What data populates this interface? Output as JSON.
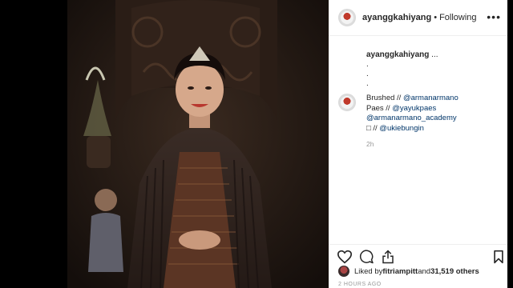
{
  "post": {
    "username": "ayanggkahiyang",
    "separator": "•",
    "follow_status": "Following"
  },
  "caption": {
    "username": "ayanggkahiyang",
    "text": "...",
    "dot1": ".",
    "dot2": ".",
    "dot3": "."
  },
  "comment": {
    "line1_prefix": "Brushed // ",
    "line1_mention": "@armanarmano",
    "line2_prefix": "Paes // ",
    "line2_mention": "@yayukpaes",
    "line3_mention": "@armanarmano_academy",
    "line4_prefix": "□ // ",
    "line4_mention": "@ukiebungin",
    "time": "2h"
  },
  "likes": {
    "prefix": "Liked by ",
    "user": "fitriampitt",
    "middle": " and ",
    "count": "31,519 others"
  },
  "posted_ago": "2 HOURS AGO",
  "icons": {
    "more": "more-options-icon",
    "like": "heart-icon",
    "comment": "comment-icon",
    "share": "share-icon",
    "save": "bookmark-icon"
  },
  "colors": {
    "mention": "#003569",
    "muted": "#999999",
    "text": "#262626"
  }
}
